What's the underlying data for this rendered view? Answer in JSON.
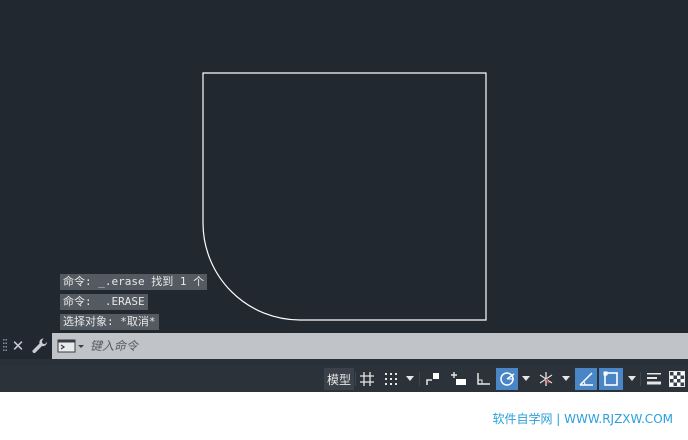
{
  "history": {
    "line1": "命令: _.erase 找到 1 个",
    "line2": "命令:  .ERASE",
    "line3": "选择对象: *取消*"
  },
  "command_line": {
    "placeholder": "键入命令"
  },
  "statusbar": {
    "model_tab": "模型",
    "buttons": [
      {
        "name": "grid-icon",
        "active": false
      },
      {
        "name": "snap-dots-icon",
        "active": false
      },
      {
        "name": "chevron-down-icon",
        "active": false
      },
      {
        "name": "infer-constraints-icon",
        "active": false
      },
      {
        "name": "dynamic-input-icon",
        "active": false
      },
      {
        "name": "ortho-icon",
        "active": false
      },
      {
        "name": "polar-tracking-icon",
        "active": true
      },
      {
        "name": "chevron-down-icon",
        "active": false
      },
      {
        "name": "isodraft-icon",
        "active": false
      },
      {
        "name": "chevron-down-icon",
        "active": false
      },
      {
        "name": "object-snap-tracking-icon",
        "active": true
      },
      {
        "name": "object-snap-icon",
        "active": true
      },
      {
        "name": "chevron-down-icon",
        "active": false
      },
      {
        "name": "lineweight-icon",
        "active": false
      },
      {
        "name": "transparency-icon",
        "active": false
      }
    ]
  },
  "colors": {
    "canvas_bg": "#212830",
    "command_bar": "#c0c3c7",
    "status_bar": "#2b323a",
    "active_toggle": "#4a86c5",
    "watermark": "#2aa0dc"
  },
  "watermark": "软件自学网 | WWW.RJZXW.COM"
}
